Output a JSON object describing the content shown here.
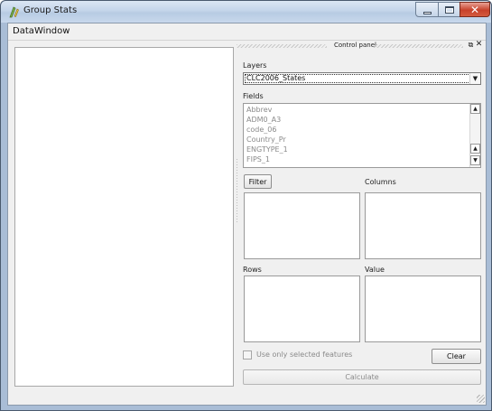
{
  "window": {
    "title": "Group Stats"
  },
  "menubar": {
    "items": [
      "Data",
      "Window"
    ]
  },
  "dock": {
    "title": "Control panel"
  },
  "layers": {
    "label": "Layers",
    "selected": "CLC2006_States"
  },
  "fields": {
    "label": "Fields",
    "items": [
      "Abbrev",
      "ADM0_A3",
      "code_06",
      "Country_Pr",
      "ENGTYPE_1",
      "FIPS_1"
    ]
  },
  "buttons": {
    "filter": "Filter",
    "clear": "Clear",
    "calculate": "Calculate"
  },
  "zones": {
    "columns": "Columns",
    "rows": "Rows",
    "value": "Value"
  },
  "options": {
    "selected_only": "Use only selected features"
  },
  "colors": {
    "titlebar": "#c4d5ea",
    "close_button": "#c7412a",
    "panel_bg": "#f0f0f0"
  }
}
